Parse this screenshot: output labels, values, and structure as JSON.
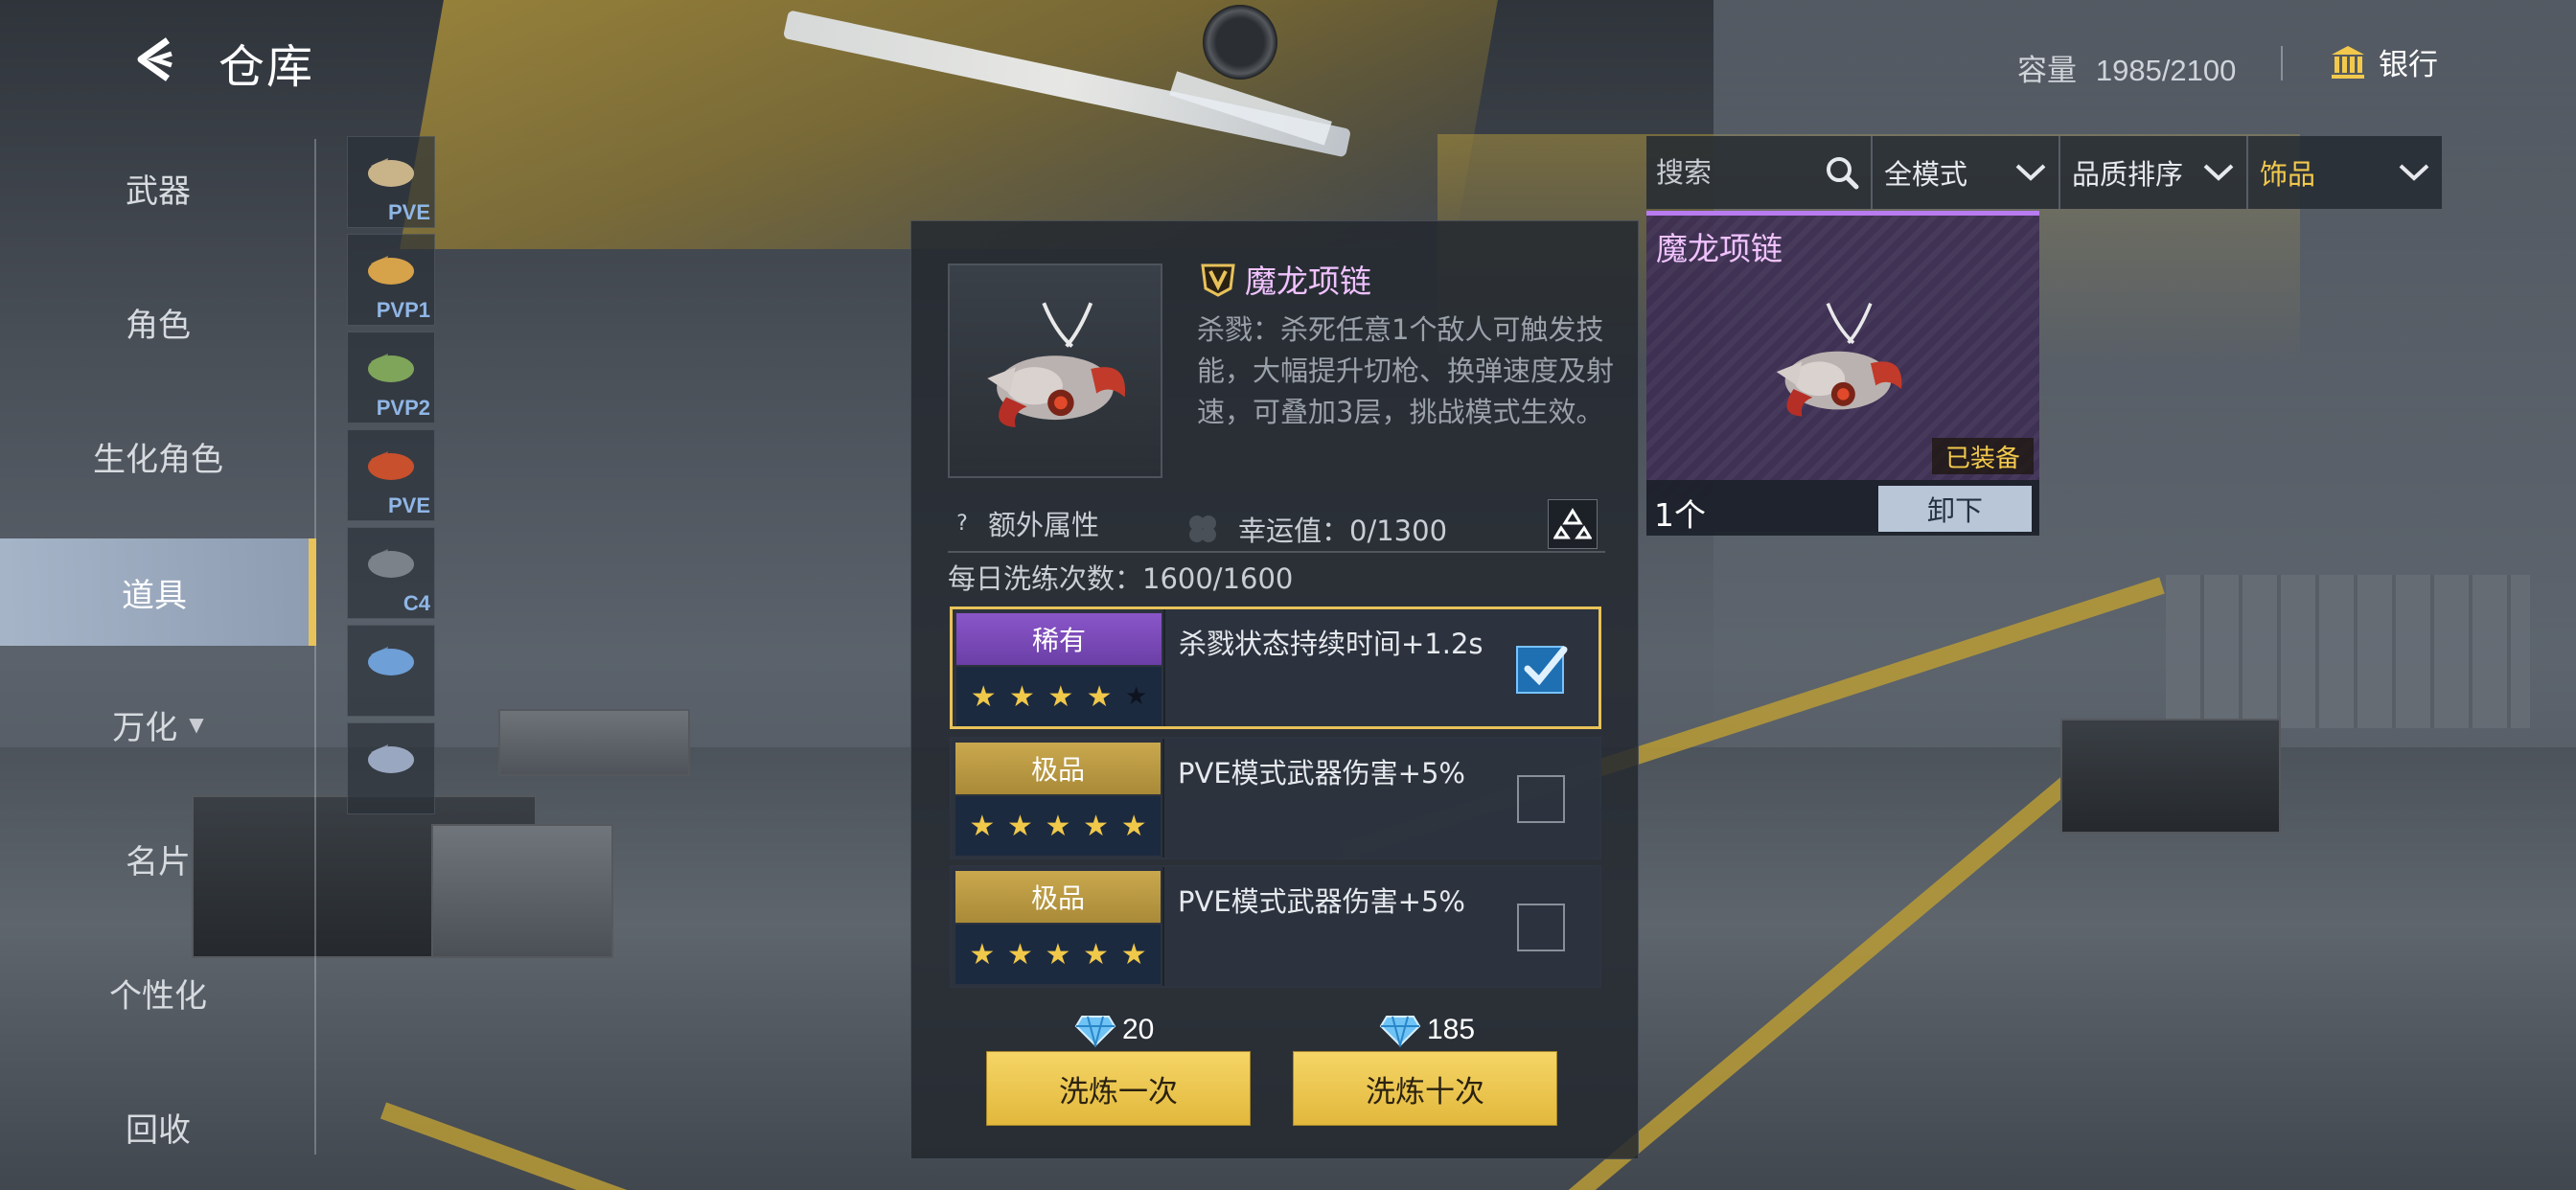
{
  "header": {
    "title": "仓库",
    "capacity_label": "容量",
    "capacity_value": "1985/2100",
    "bank_label": "银行"
  },
  "sidebar": {
    "items": [
      {
        "label": "武器"
      },
      {
        "label": "角色"
      },
      {
        "label": "生化角色"
      },
      {
        "label": "道具",
        "active": true
      },
      {
        "label": "万化"
      },
      {
        "label": "名片"
      },
      {
        "label": "个性化"
      },
      {
        "label": "回收"
      }
    ]
  },
  "thumbnails": [
    {
      "label": "PVE"
    },
    {
      "label": "PVP1"
    },
    {
      "label": "PVP2"
    },
    {
      "label": "PVE"
    },
    {
      "label": "C4"
    },
    {
      "label": ""
    },
    {
      "label": ""
    }
  ],
  "detail": {
    "name": "魔龙项链",
    "description": "杀戮：杀死任意1个敌人可触发技能，大幅提升切枪、换弹速度及射速，可叠加3层，挑战模式生效。",
    "extra_attr_label": "额外属性",
    "luck_label": "幸运值：0/1300",
    "daily_label": "每日洗练次数：1600/1600",
    "options": [
      {
        "rank": "稀有",
        "rank_type": "rare",
        "stars": 4,
        "max_stars": 5,
        "effect": "杀戮状态持续时间+1.2s",
        "checked": true
      },
      {
        "rank": "极品",
        "rank_type": "supreme",
        "stars": 5,
        "max_stars": 5,
        "effect": "PVE模式武器伤害+5%",
        "checked": false
      },
      {
        "rank": "极品",
        "rank_type": "supreme",
        "stars": 5,
        "max_stars": 5,
        "effect": "PVE模式武器伤害+5%",
        "checked": false
      }
    ],
    "cost_once": "20",
    "cost_ten": "185",
    "refine_once_label": "洗炼一次",
    "refine_ten_label": "洗炼十次"
  },
  "filters": {
    "search_placeholder": "搜索",
    "mode": "全模式",
    "sort": "品质排序",
    "category": "饰品"
  },
  "equipped_card": {
    "name": "魔龙项链",
    "status": "已装备",
    "count": "1个",
    "unequip_label": "卸下"
  },
  "colors": {
    "accent_gold": "#e8c25a",
    "rare_purple": "#8a56c9",
    "supreme_gold": "#c9a84e",
    "name_pink": "#f0c2ff"
  },
  "icons": {
    "back": "back-chevron-icon",
    "bank": "bank-icon",
    "search": "search-icon",
    "luck": "clover-icon",
    "recycle": "recycle-icon",
    "currency": "diamond-icon",
    "badge": "v-badge-icon"
  }
}
